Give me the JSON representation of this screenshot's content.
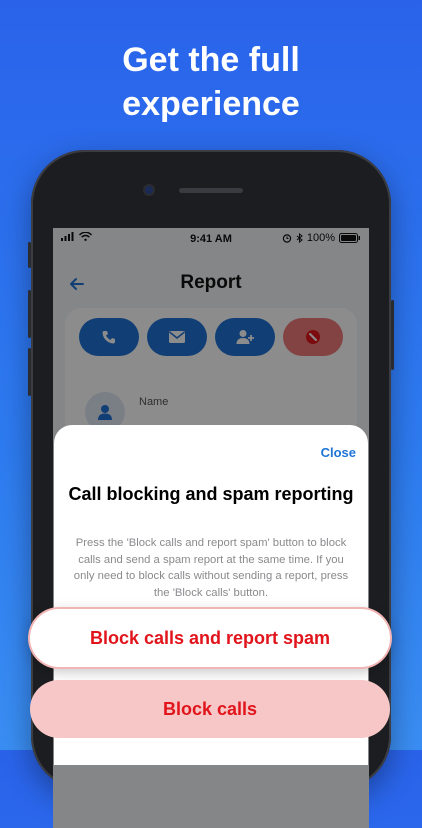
{
  "headline": {
    "line1": "Get the full",
    "line2": "experience"
  },
  "status_bar": {
    "time": "9:41 AM",
    "battery": "100%"
  },
  "nav": {
    "title": "Report"
  },
  "contact": {
    "name_label": "Name"
  },
  "sheet": {
    "close_label": "Close",
    "title": "Call blocking and spam reporting",
    "description": "Press the 'Block calls and report spam' button to block calls and send a spam report at the same time. If you only need to block calls without sending a report, press the 'Block calls' button."
  },
  "buttons": {
    "block_and_report": "Block calls and report spam",
    "block_only": "Block calls"
  },
  "colors": {
    "background": "#2a63ea",
    "accent": "#1f74d6",
    "danger_text": "#e1141b",
    "danger_button_bg": "#f6c7c6"
  }
}
